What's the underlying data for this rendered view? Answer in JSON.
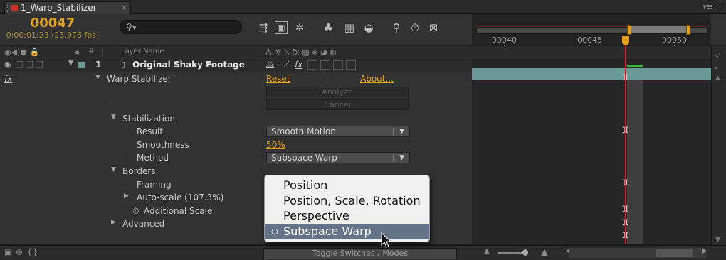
{
  "tab": {
    "title": "1_Warp_Stabilizer",
    "close": "×"
  },
  "header": {
    "timecode": "00047",
    "timecode_sub": "0:00:01:23 (23.976 fps)",
    "search_placeholder": "⚲▾"
  },
  "ruler": {
    "labels": [
      "00040",
      "00045",
      "00050"
    ]
  },
  "columns": {
    "hash": "#",
    "layer_name": "Layer Name"
  },
  "layer": {
    "number": "1",
    "name": "Original Shaky Footage",
    "fx": "fx"
  },
  "effect": {
    "name": "Warp Stabilizer",
    "reset": "Reset",
    "about": "About...",
    "analyze": "Analyze",
    "cancel": "Cancel"
  },
  "properties": {
    "stabilization": "Stabilization",
    "result": "Result",
    "result_value": "Smooth Motion",
    "smoothness": "Smoothness",
    "smoothness_value": "50%",
    "method": "Method",
    "method_value": "Subspace Warp",
    "borders": "Borders",
    "framing": "Framing",
    "autoscale": "Auto-scale (107.3%)",
    "additional_scale": "Additional Scale",
    "advanced": "Advanced"
  },
  "popup": {
    "items": [
      "Position",
      "Position, Scale, Rotation",
      "Perspective",
      "Subspace Warp"
    ],
    "selected": "Subspace Warp"
  },
  "bottom": {
    "toggle_label": "Toggle Switches / Modes"
  },
  "colors": {
    "accent": "#e3a11b",
    "layer_bar": "#6a9a97",
    "cti": "#e02020",
    "menu_select": "#647387"
  }
}
